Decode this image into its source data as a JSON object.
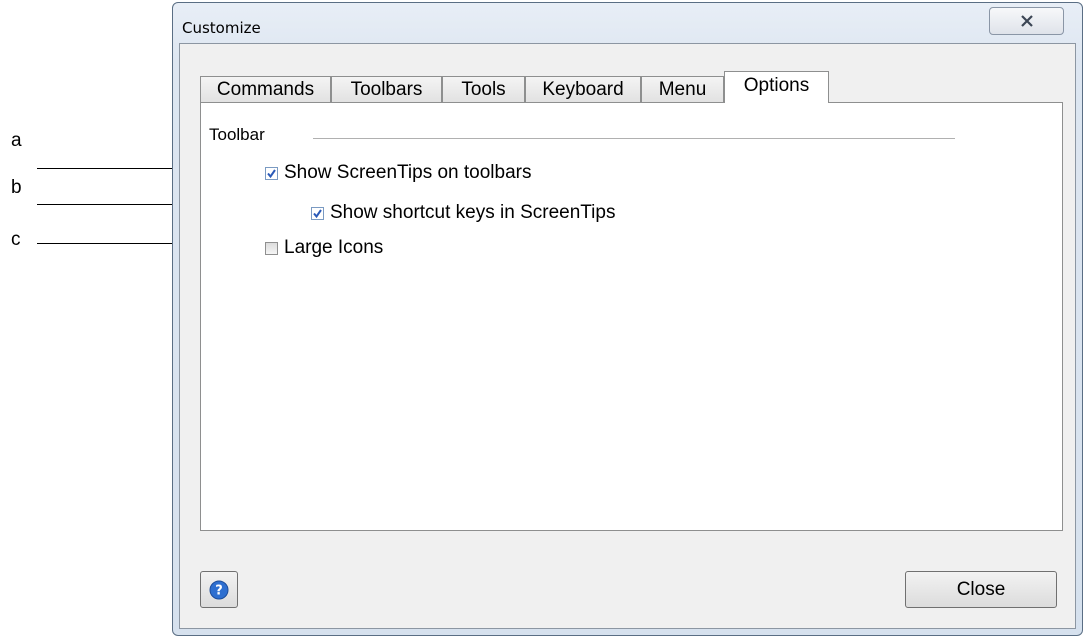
{
  "window": {
    "title": "Customize"
  },
  "tabs": [
    {
      "label": "Commands"
    },
    {
      "label": "Toolbars"
    },
    {
      "label": "Tools"
    },
    {
      "label": "Keyboard"
    },
    {
      "label": "Menu"
    },
    {
      "label": "Options",
      "active": true
    }
  ],
  "toolbar_group": {
    "label": "Toolbar",
    "options": [
      {
        "label": "Show ScreenTips on toolbars",
        "checked": true
      },
      {
        "label": "Show shortcut keys in ScreenTips",
        "checked": true
      },
      {
        "label": "Large Icons",
        "checked": false
      }
    ]
  },
  "buttons": {
    "close_label": "Close"
  },
  "annotations": [
    "a",
    "b",
    "c"
  ],
  "icons": {
    "title_close": "close-x-icon",
    "help": "help-icon",
    "check": "checkmark-icon"
  },
  "colors": {
    "checkmark": "#2a5ab8",
    "help_icon": "#2e6fd0"
  }
}
